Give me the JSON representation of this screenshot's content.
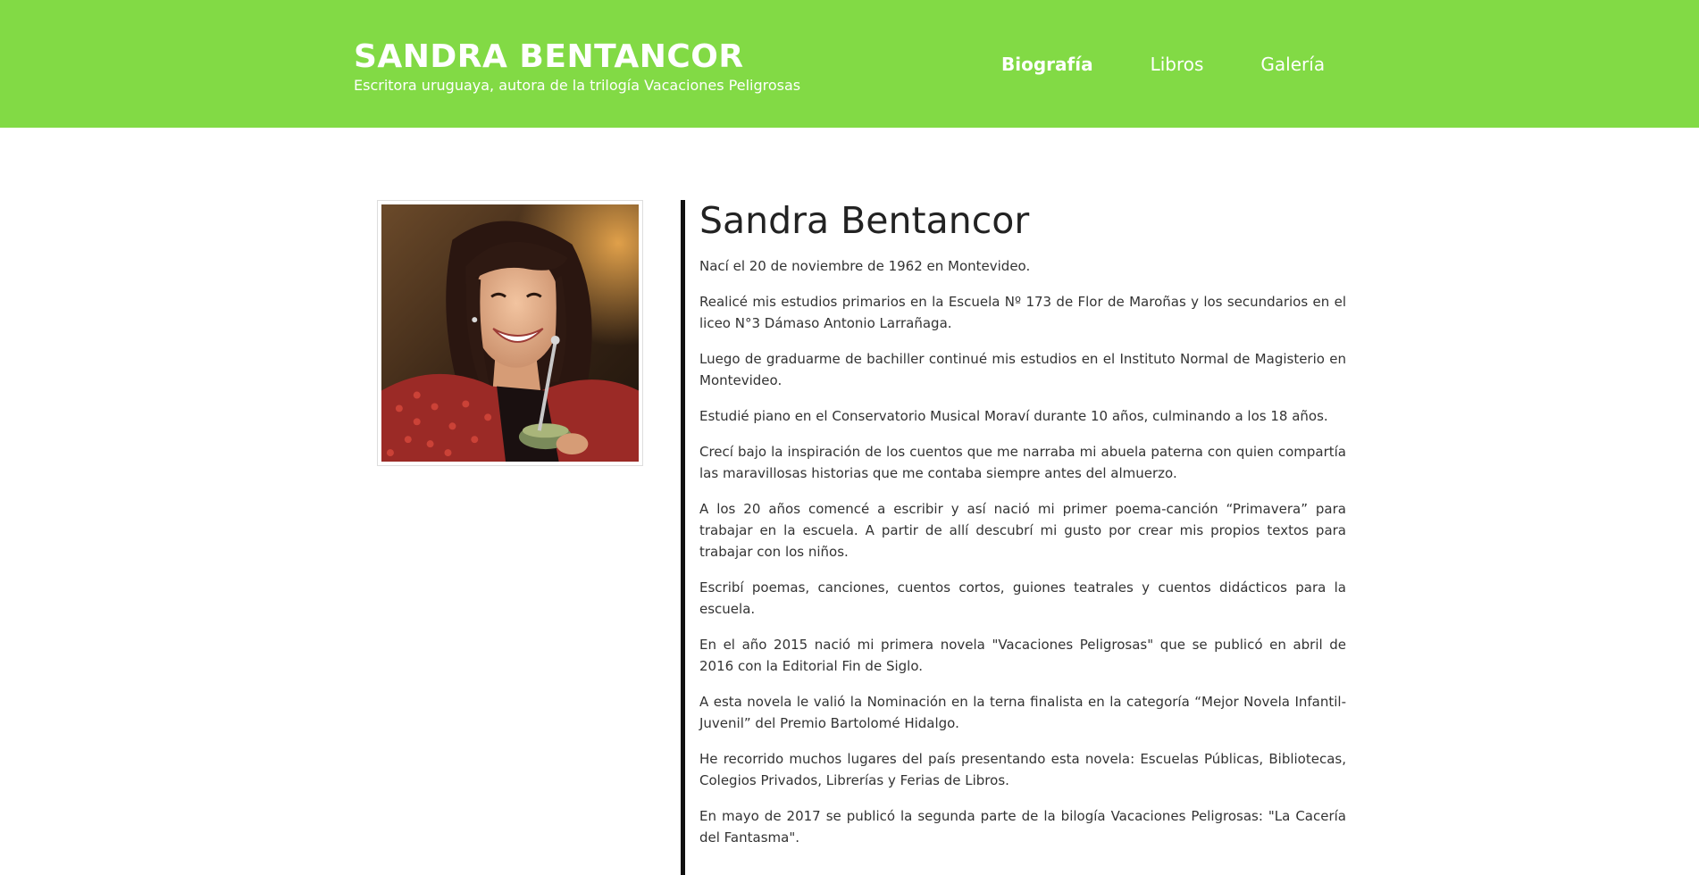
{
  "header": {
    "title": "SANDRA BENTANCOR",
    "subtitle": "Escritora uruguaya, autora de la trilogía Vacaciones Peligrosas",
    "background_color": "#82da45"
  },
  "nav": {
    "items": [
      {
        "label": "Biografía",
        "active": true
      },
      {
        "label": "Libros",
        "active": false
      },
      {
        "label": "Galería",
        "active": false
      }
    ]
  },
  "profile": {
    "photo_icon": "author-portrait-photo"
  },
  "bio": {
    "heading": "Sandra Bentancor",
    "paragraphs": [
      "Nací el 20 de noviembre de 1962 en Montevideo.",
      "Realicé mis estudios primarios en la Escuela Nº 173 de Flor de Maroñas y los secundarios en el liceo N°3 Dámaso Antonio Larrañaga.",
      "Luego de graduarme de bachiller continué mis estudios en el Instituto Normal de Magisterio en Montevideo.",
      "Estudié piano en el Conservatorio Musical Moraví durante 10 años, culminando a los 18 años.",
      "Crecí bajo la inspiración de los cuentos que me narraba mi abuela paterna con quien compartía las maravillosas historias que me contaba siempre antes del almuerzo.",
      "A los 20 años comencé a escribir y así nació mi primer poema-canción “Primavera” para trabajar en la escuela. A partir de allí descubrí mi gusto por crear mis propios textos para trabajar con los niños.",
      "Escribí poemas, canciones, cuentos cortos, guiones teatrales y cuentos didácticos para la escuela.",
      "En el año 2015 nació mi primera novela \"Vacaciones Peligrosas\" que se publicó en abril de 2016 con la Editorial Fin de Siglo.",
      "A esta novela le valió la Nominación en la terna finalista en la categoría “Mejor Novela Infantil-Juvenil” del Premio Bartolomé Hidalgo.",
      "He recorrido muchos lugares del país presentando esta novela: Escuelas Públicas, Bibliotecas, Colegios Privados, Librerías y Ferias de Libros.",
      "En mayo de 2017 se publicó la segunda parte de la bilogía Vacaciones Peligrosas: \"La Cacería del Fantasma\"."
    ]
  }
}
